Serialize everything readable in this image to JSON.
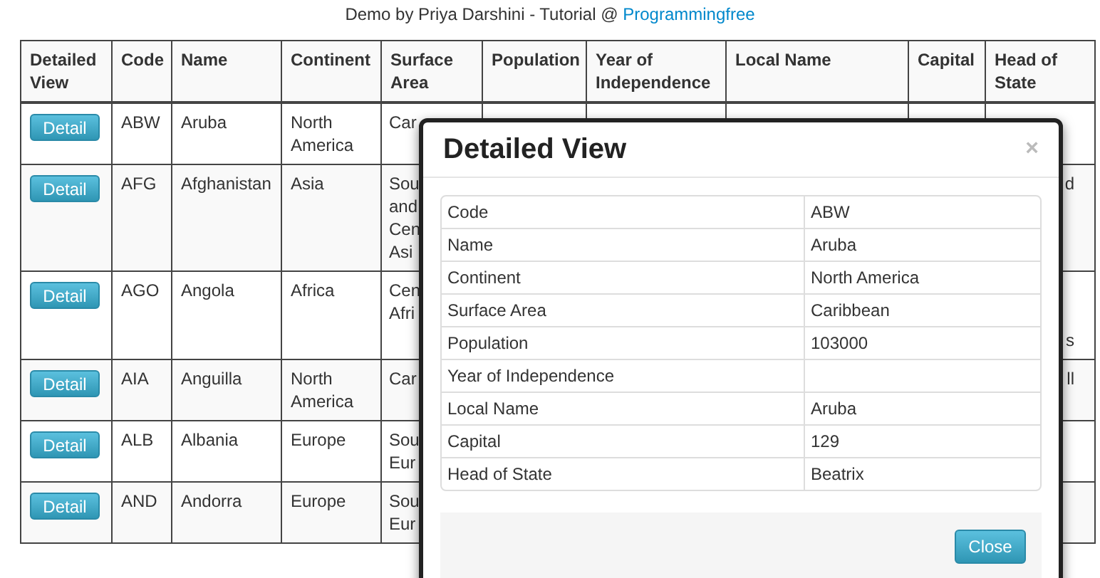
{
  "credit": {
    "text": "Demo by Priya Darshini - Tutorial @ ",
    "link": "Programmingfree"
  },
  "table": {
    "columns": [
      "Detailed View",
      "Code",
      "Name",
      "Continent",
      "Surface Area",
      "Population",
      "Year of Independence",
      "Local Name",
      "Capital",
      "Head of State"
    ],
    "rows": [
      {
        "button": "Detail",
        "code": "ABW",
        "name": "Aruba",
        "continent": "North America",
        "surface_area": "Car"
      },
      {
        "button": "Detail",
        "code": "AFG",
        "name": "Afghanistan",
        "continent": "Asia",
        "surface_area": "Sou\nand\nCen\nAsi",
        "head_of_state": "d"
      },
      {
        "button": "Detail",
        "code": "AGO",
        "name": "Angola",
        "continent": "Africa",
        "surface_area": "Cen\nAfri",
        "head_of_state": "s"
      },
      {
        "button": "Detail",
        "code": "AIA",
        "name": "Anguilla",
        "continent": "North America",
        "surface_area": "Car",
        "head_of_state": "ll"
      },
      {
        "button": "Detail",
        "code": "ALB",
        "name": "Albania",
        "continent": "Europe",
        "surface_area": "Sou\nEur"
      },
      {
        "button": "Detail",
        "code": "AND",
        "name": "Andorra",
        "continent": "Europe",
        "surface_area": "Sou\nEur"
      }
    ]
  },
  "modal": {
    "title": "Detailed View",
    "close_icon": "×",
    "fields": [
      {
        "label": "Code",
        "value": "ABW"
      },
      {
        "label": "Name",
        "value": "Aruba"
      },
      {
        "label": "Continent",
        "value": "North America"
      },
      {
        "label": "Surface Area",
        "value": "Caribbean"
      },
      {
        "label": "Population",
        "value": "103000"
      },
      {
        "label": "Year of Independence"
      },
      {
        "label": "Local Name",
        "value": "Aruba"
      },
      {
        "label": "Capital",
        "value": "129"
      },
      {
        "label": "Head of State",
        "value": "Beatrix"
      }
    ],
    "button": "Close"
  }
}
